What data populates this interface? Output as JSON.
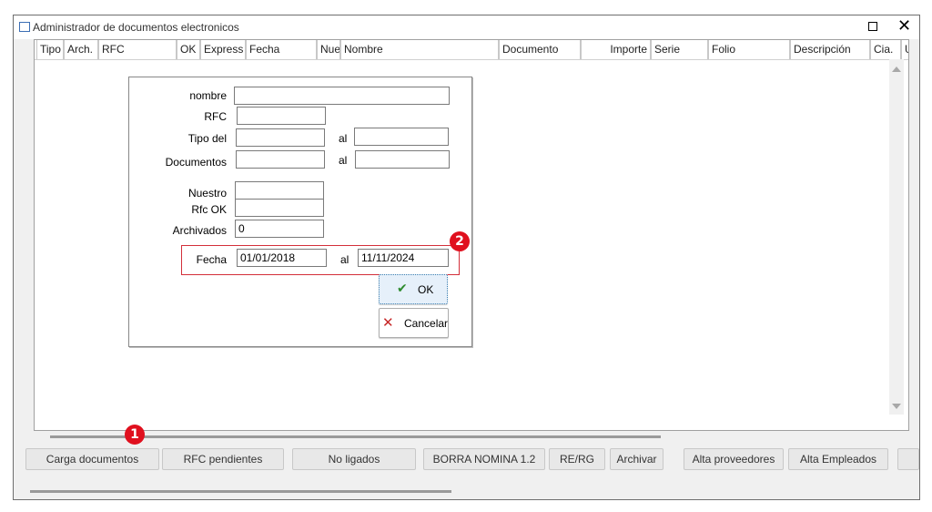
{
  "window": {
    "title": "Administrador de documentos electronicos"
  },
  "grid": {
    "columns": [
      "Tipo",
      "Arch.",
      "RFC",
      "OK",
      "Express",
      "Fecha",
      "Nue",
      "Nombre",
      "Documento",
      "Importe",
      "Serie",
      "Folio",
      "Descripción",
      "Cia.",
      "U"
    ]
  },
  "dialog": {
    "labels": {
      "nombre": "nombre",
      "rfc": "RFC",
      "tipo_del": "Tipo del",
      "documentos": "Documentos",
      "nuestro": "Nuestro",
      "rfc_ok": "Rfc OK",
      "archivados": "Archivados",
      "fecha": "Fecha",
      "al": "al"
    },
    "values": {
      "archivados": "0",
      "fecha_desde": "01/01/2018",
      "fecha_hasta": "11/11/2024"
    },
    "ok_label": "OK",
    "cancel_label": "Cancelar"
  },
  "badges": {
    "one": "1",
    "two": "2"
  },
  "toolbar": {
    "buttons": [
      "Carga documentos",
      "RFC pendientes",
      "No ligados",
      "BORRA NOMINA 1.2",
      "RE/RG",
      "Archivar",
      "Alta proveedores",
      "Alta Empleados"
    ]
  },
  "colors": {
    "highlight": "#d32f3a",
    "badge": "#e0101e",
    "ok_check": "#2e8b2e",
    "cancel_x": "#c62828"
  }
}
